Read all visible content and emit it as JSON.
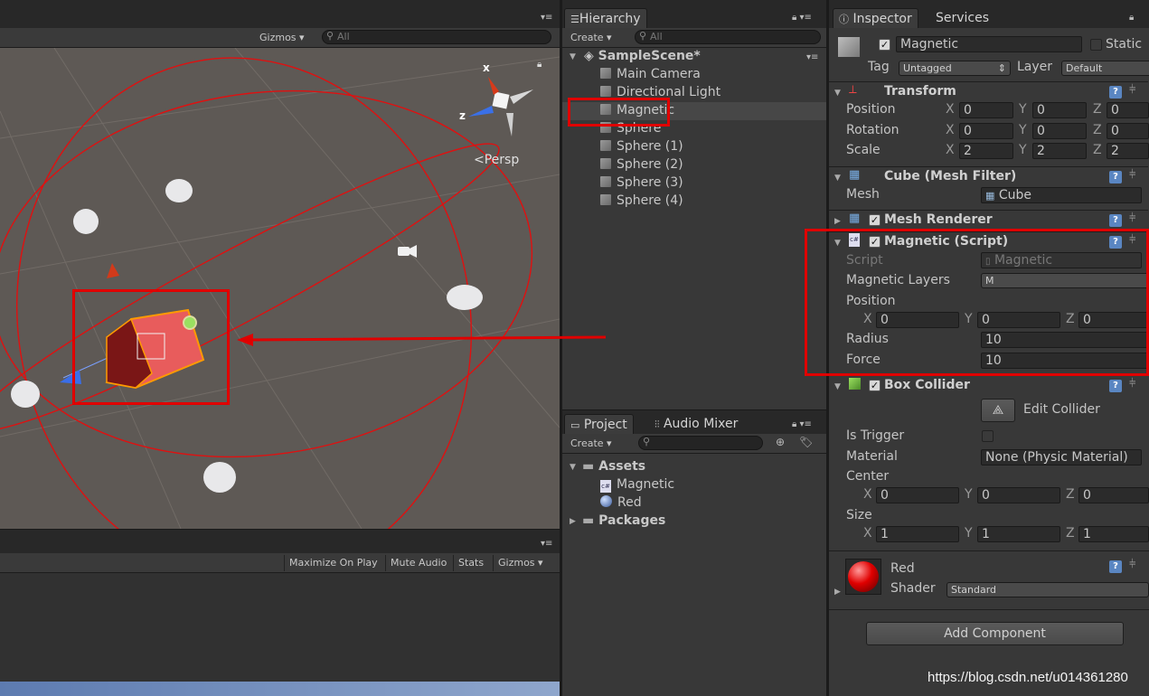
{
  "scene": {
    "gizmos_label": "Gizmos",
    "search_placeholder": "All",
    "persp_label": "Persp",
    "gizmo_x": "x",
    "gizmo_z": "z"
  },
  "game": {
    "maximize_label": "Maximize On Play",
    "mute_label": "Mute Audio",
    "stats_label": "Stats",
    "gizmos_label": "Gizmos"
  },
  "hierarchy": {
    "tab": "Hierarchy",
    "create_label": "Create",
    "search_placeholder": "All",
    "scene_name": "SampleScene*",
    "items": [
      "Main Camera",
      "Directional Light",
      "Magnetic",
      "Sphere",
      "Sphere (1)",
      "Sphere (2)",
      "Sphere (3)",
      "Sphere (4)"
    ]
  },
  "project": {
    "tab": "Project",
    "audio_tab": "Audio Mixer",
    "create_label": "Create",
    "assets_label": "Assets",
    "assets": [
      "Magnetic",
      "Red"
    ],
    "packages_label": "Packages"
  },
  "inspector": {
    "tab": "Inspector",
    "services_tab": "Services",
    "object_name": "Magnetic",
    "static_label": "Static",
    "tag_label": "Tag",
    "tag_value": "Untagged",
    "layer_label": "Layer",
    "layer_value": "Default",
    "transform": {
      "title": "Transform",
      "position_label": "Position",
      "rotation_label": "Rotation",
      "scale_label": "Scale",
      "position": [
        "0",
        "0",
        "0"
      ],
      "rotation": [
        "0",
        "0",
        "0"
      ],
      "scale": [
        "2",
        "2",
        "2"
      ]
    },
    "mesh_filter": {
      "title": "Cube (Mesh Filter)",
      "mesh_label": "Mesh",
      "mesh_value": "Cube"
    },
    "mesh_renderer": {
      "title": "Mesh Renderer"
    },
    "magnetic_script": {
      "title": "Magnetic (Script)",
      "script_label": "Script",
      "script_value": "Magnetic",
      "layers_label": "Magnetic Layers",
      "layers_value": "M",
      "position_label": "Position",
      "position": [
        "0",
        "0",
        "0"
      ],
      "radius_label": "Radius",
      "radius_value": "10",
      "force_label": "Force",
      "force_value": "10"
    },
    "box_collider": {
      "title": "Box Collider",
      "edit_label": "Edit Collider",
      "trigger_label": "Is Trigger",
      "material_label": "Material",
      "material_value": "None (Physic Material)",
      "center_label": "Center",
      "center": [
        "0",
        "0",
        "0"
      ],
      "size_label": "Size",
      "size": [
        "1",
        "1",
        "1"
      ]
    },
    "material": {
      "name": "Red",
      "shader_label": "Shader",
      "shader_value": "Standard"
    },
    "add_component_label": "Add Component"
  },
  "axes": {
    "x": "X",
    "y": "Y",
    "z": "Z"
  },
  "watermark": "https://blog.csdn.net/u014361280"
}
